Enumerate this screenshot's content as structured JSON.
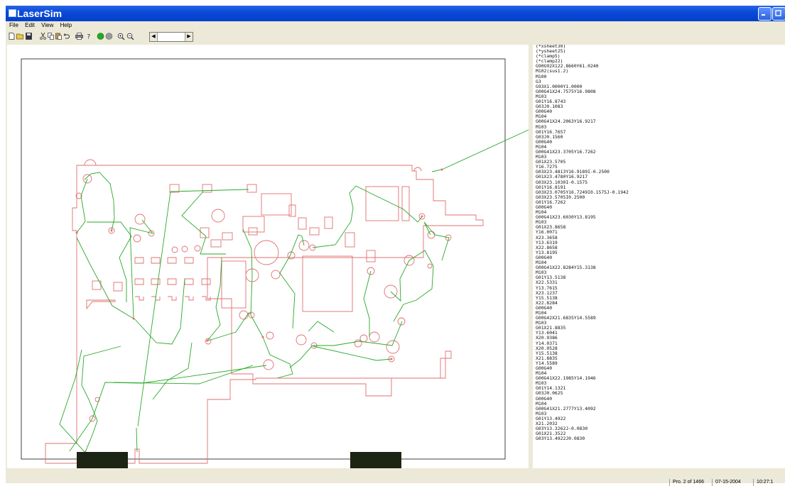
{
  "window": {
    "title": "LaserSim"
  },
  "menu": {
    "items": [
      "File",
      "Edit",
      "View",
      "Help"
    ]
  },
  "toolbar": {
    "icons": [
      "new-file-icon",
      "open-folder-icon",
      "save-icon",
      "cut-icon",
      "copy-icon",
      "paste-icon",
      "undo-icon",
      "print-icon",
      "help-icon",
      "run-green-icon",
      "stop-icon",
      "zoom-in-icon",
      "zoom-out-icon"
    ],
    "colors": {
      "run": "#22aa22",
      "stop": "#9a9a9a"
    }
  },
  "colors": {
    "part_outline": "#e07070",
    "toolpath": "#2aa82a",
    "sheet_border": "#404040",
    "clamp": "#1c2414",
    "titlebar": "#0a4ad8"
  },
  "gcode": {
    "lines": [
      "(*xsheet30)",
      "(*ysheet25)",
      "(*clamp5)",
      "(*clamp22)",
      "G90G92X122.8660Y61.0240",
      "M102(sus1.2)",
      "M100",
      "G3",
      "G93X1.0000Y1.0000",
      "G00G41X24.7575Y16.9808",
      "M103",
      "G01Y16.8743",
      "G03J0.1083",
      "G00G40",
      "M104",
      "G00G41X24.2063Y16.9217",
      "M103",
      "G01Y16.7657",
      "G03J0.1560",
      "G00G40",
      "M104",
      "G00G41X23.3705Y16.7262",
      "M103",
      "G01X23.5705",
      "Y16.7275",
      "G03X23.4813Y16.9189I-0.2500",
      "G01X23.4780Y16.9217",
      "G03X23.1030I-0.1575",
      "G01Y16.8191",
      "G03X23.0705Y16.7249I0.1575J-0.1942",
      "G03X23.5705I0.2500",
      "G01Y16.7262",
      "G00G40",
      "M104",
      "G00G41X23.6030Y13.8195",
      "M103",
      "G01X23.8658",
      "Y16.0071",
      "X23.3658",
      "Y13.6319",
      "X22.8658",
      "Y13.8195",
      "G00G40",
      "M104",
      "G00G41X22.8284Y15.3138",
      "M103",
      "G01Y13.5138",
      "X22.5331",
      "Y13.7615",
      "X23.1237",
      "Y15.5138",
      "X22.8284",
      "G00G40",
      "M104",
      "G00G42X21.6835Y14.5589",
      "M103",
      "G01X21.8835",
      "Y13.6041",
      "X20.9386",
      "Y14.0371",
      "X20.0528",
      "Y15.5138",
      "X21.8835",
      "Y14.5589",
      "G00G40",
      "M104",
      "G00G41X22.1985Y14.1946",
      "M103",
      "G01Y14.1321",
      "G03J0.0625",
      "G00G40",
      "M104",
      "G00G41X21.2777Y13.4092",
      "M103",
      "G01Y13.4922",
      "X21.2032",
      "G03Y13.3262J-0.0830",
      "G01X21.3522",
      "G03Y13.4922J0.0830"
    ]
  },
  "status": {
    "progress": "Pro. 2 of 1466",
    "date": "07-15-2004",
    "time": "10:27:1"
  }
}
